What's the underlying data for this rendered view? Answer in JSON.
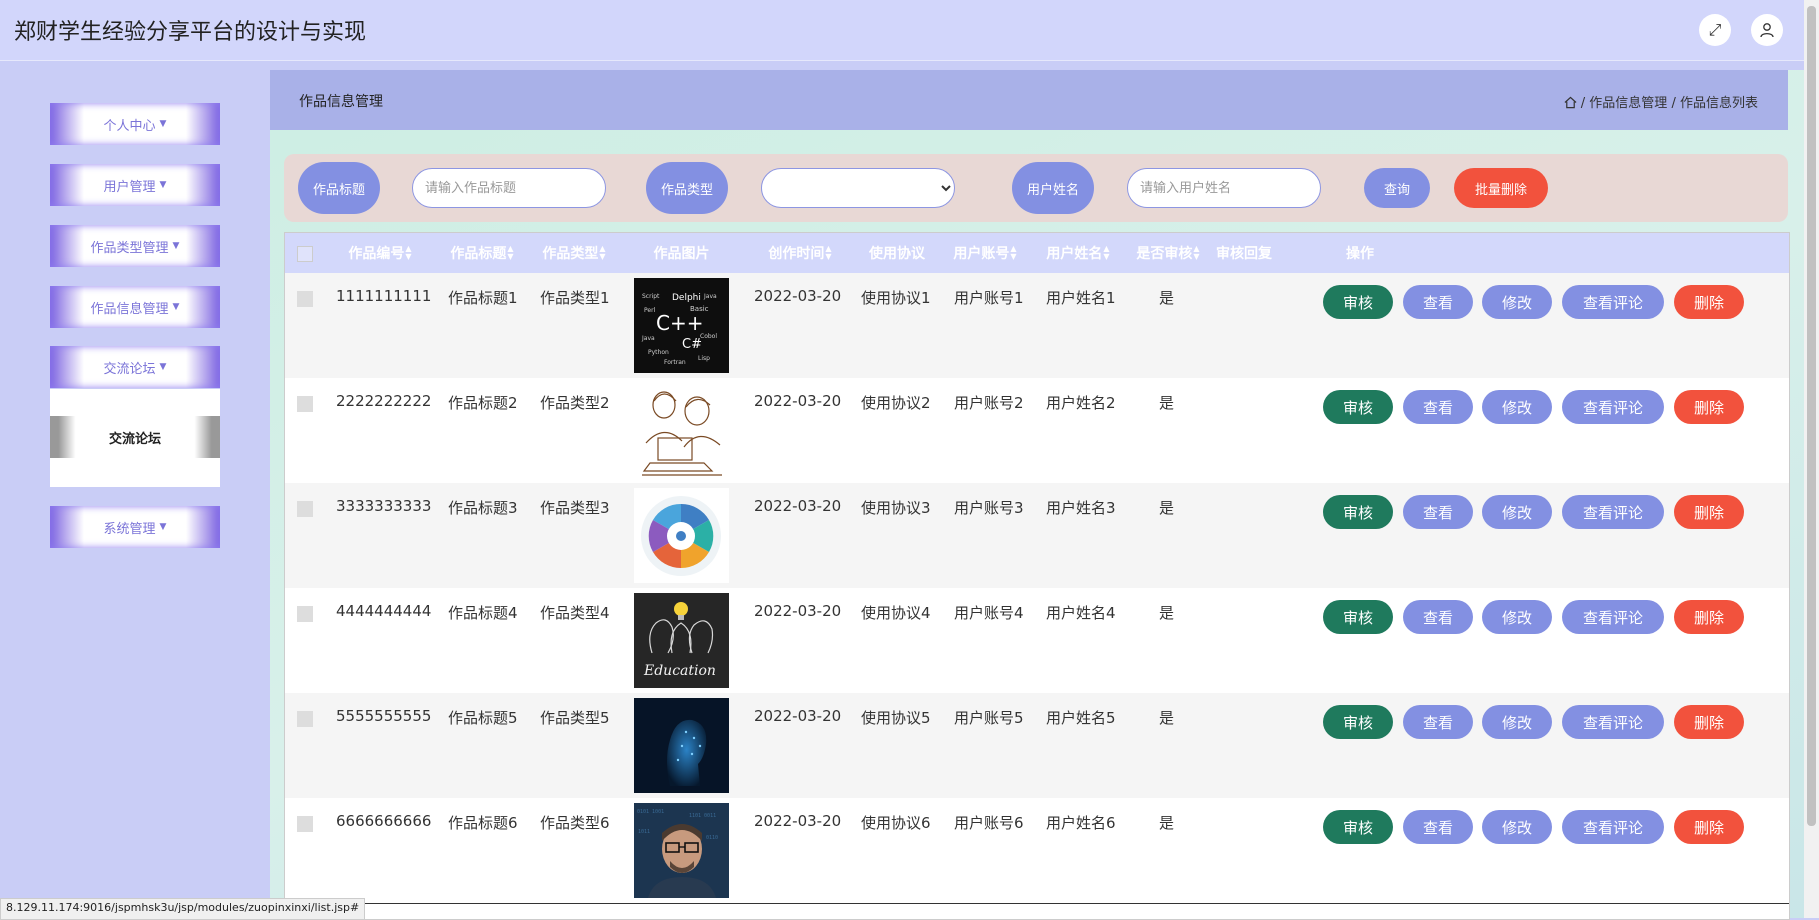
{
  "app": {
    "title": "郑财学生经验分享平台的设计与实现"
  },
  "topbar": {
    "fullscreen_icon": "fullscreen-icon",
    "user_icon": "user-icon"
  },
  "sidebar": {
    "items": [
      {
        "label": "个人中心"
      },
      {
        "label": "用户管理"
      },
      {
        "label": "作品类型管理"
      },
      {
        "label": "作品信息管理"
      },
      {
        "label": "交流论坛"
      },
      {
        "label": "系统管理"
      }
    ],
    "submenu": {
      "label": "交流论坛"
    }
  },
  "page": {
    "title": "作品信息管理",
    "breadcrumb": [
      "作品信息管理",
      "作品信息列表"
    ],
    "breadcrumb_sep": "/"
  },
  "search": {
    "title_label": "作品标题",
    "title_placeholder": "请输入作品标题",
    "type_label": "作品类型",
    "type_value": "",
    "user_label": "用户姓名",
    "user_placeholder": "请输入用户姓名",
    "query_label": "查询",
    "batch_delete_label": "批量删除"
  },
  "table": {
    "columns": [
      "作品编号",
      "作品标题",
      "作品类型",
      "作品图片",
      "创作时间",
      "使用协议",
      "用户账号",
      "用户姓名",
      "是否审核",
      "审核回复",
      "操作"
    ],
    "actions": {
      "audit": "审核",
      "view": "查看",
      "edit": "修改",
      "comments": "查看评论",
      "delete": "删除"
    },
    "rows": [
      {
        "id": "1111111111",
        "title": "作品标题1",
        "type": "作品类型1",
        "image": "cpp-word-cloud",
        "time": "2022-03-20",
        "license": "使用协议1",
        "account": "用户账号1",
        "name": "用户姓名1",
        "audited": "是",
        "reply": ""
      },
      {
        "id": "2222222222",
        "title": "作品标题2",
        "type": "作品类型2",
        "image": "teacher-student-sketch",
        "time": "2022-03-20",
        "license": "使用协议2",
        "account": "用户账号2",
        "name": "用户姓名2",
        "audited": "是",
        "reply": ""
      },
      {
        "id": "3333333333",
        "title": "作品标题3",
        "type": "作品类型3",
        "image": "circular-infographic",
        "time": "2022-03-20",
        "license": "使用协议3",
        "account": "用户账号3",
        "name": "用户姓名3",
        "audited": "是",
        "reply": ""
      },
      {
        "id": "4444444444",
        "title": "作品标题4",
        "type": "作品类型4",
        "image": "education-chalkboard",
        "time": "2022-03-20",
        "license": "使用协议4",
        "account": "用户账号4",
        "name": "用户姓名4",
        "audited": "是",
        "reply": ""
      },
      {
        "id": "5555555555",
        "title": "作品标题5",
        "type": "作品类型5",
        "image": "digital-head",
        "time": "2022-03-20",
        "license": "使用协议5",
        "account": "用户账号5",
        "name": "用户姓名5",
        "audited": "是",
        "reply": ""
      },
      {
        "id": "6666666666",
        "title": "作品标题6",
        "type": "作品类型6",
        "image": "man-with-glasses",
        "time": "2022-03-20",
        "license": "使用协议6",
        "account": "用户账号6",
        "name": "用户姓名6",
        "audited": "是",
        "reply": ""
      }
    ]
  },
  "statusbar": {
    "url": "8.129.11.174:9016/jspmhsk3u/jsp/modules/zuopinxinxi/list.jsp#"
  }
}
